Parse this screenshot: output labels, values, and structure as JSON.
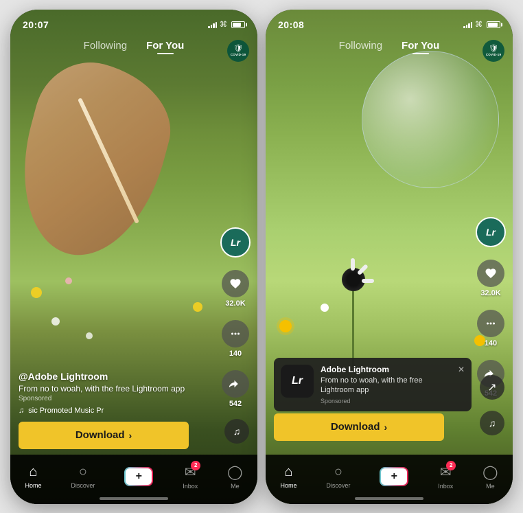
{
  "phone1": {
    "statusTime": "20:07",
    "nav": {
      "following": "Following",
      "forYou": "For You",
      "covidLabel": "COVID-19"
    },
    "actions": {
      "likes": "32.0K",
      "comments": "140",
      "shares": "542",
      "avatarLabel": "Lr"
    },
    "content": {
      "username": "@Adobe Lightroom",
      "description": "From no to woah, with the free Lightroom app",
      "sponsored": "Sponsored",
      "musicText": "sic   Promoted Music   Pr"
    },
    "downloadBtn": "Download",
    "bottomNav": {
      "home": "Home",
      "discover": "Discover",
      "inbox": "Inbox",
      "inboxBadge": "2",
      "me": "Me"
    }
  },
  "phone2": {
    "statusTime": "20:08",
    "nav": {
      "following": "Following",
      "forYou": "For You",
      "covidLabel": "COVID-19"
    },
    "actions": {
      "likes": "32.0K",
      "comments": "140",
      "shares": "542",
      "avatarLabel": "Lr"
    },
    "popup": {
      "title": "Adobe Lightroom",
      "description": "From no to woah, with the free Lightroom app",
      "sponsored": "Sponsored",
      "appIconLabel": "Lr"
    },
    "downloadBtn": "Download",
    "bottomNav": {
      "home": "Home",
      "discover": "Discover",
      "inbox": "Inbox",
      "inboxBadge": "2",
      "me": "Me"
    }
  },
  "icons": {
    "home": "🏠",
    "discover": "🔍",
    "plus": "+",
    "inbox": "✉",
    "me": "👤",
    "heart": "♥",
    "comment": "•••",
    "share": "↗",
    "note": "♫",
    "chevronRight": "›"
  }
}
